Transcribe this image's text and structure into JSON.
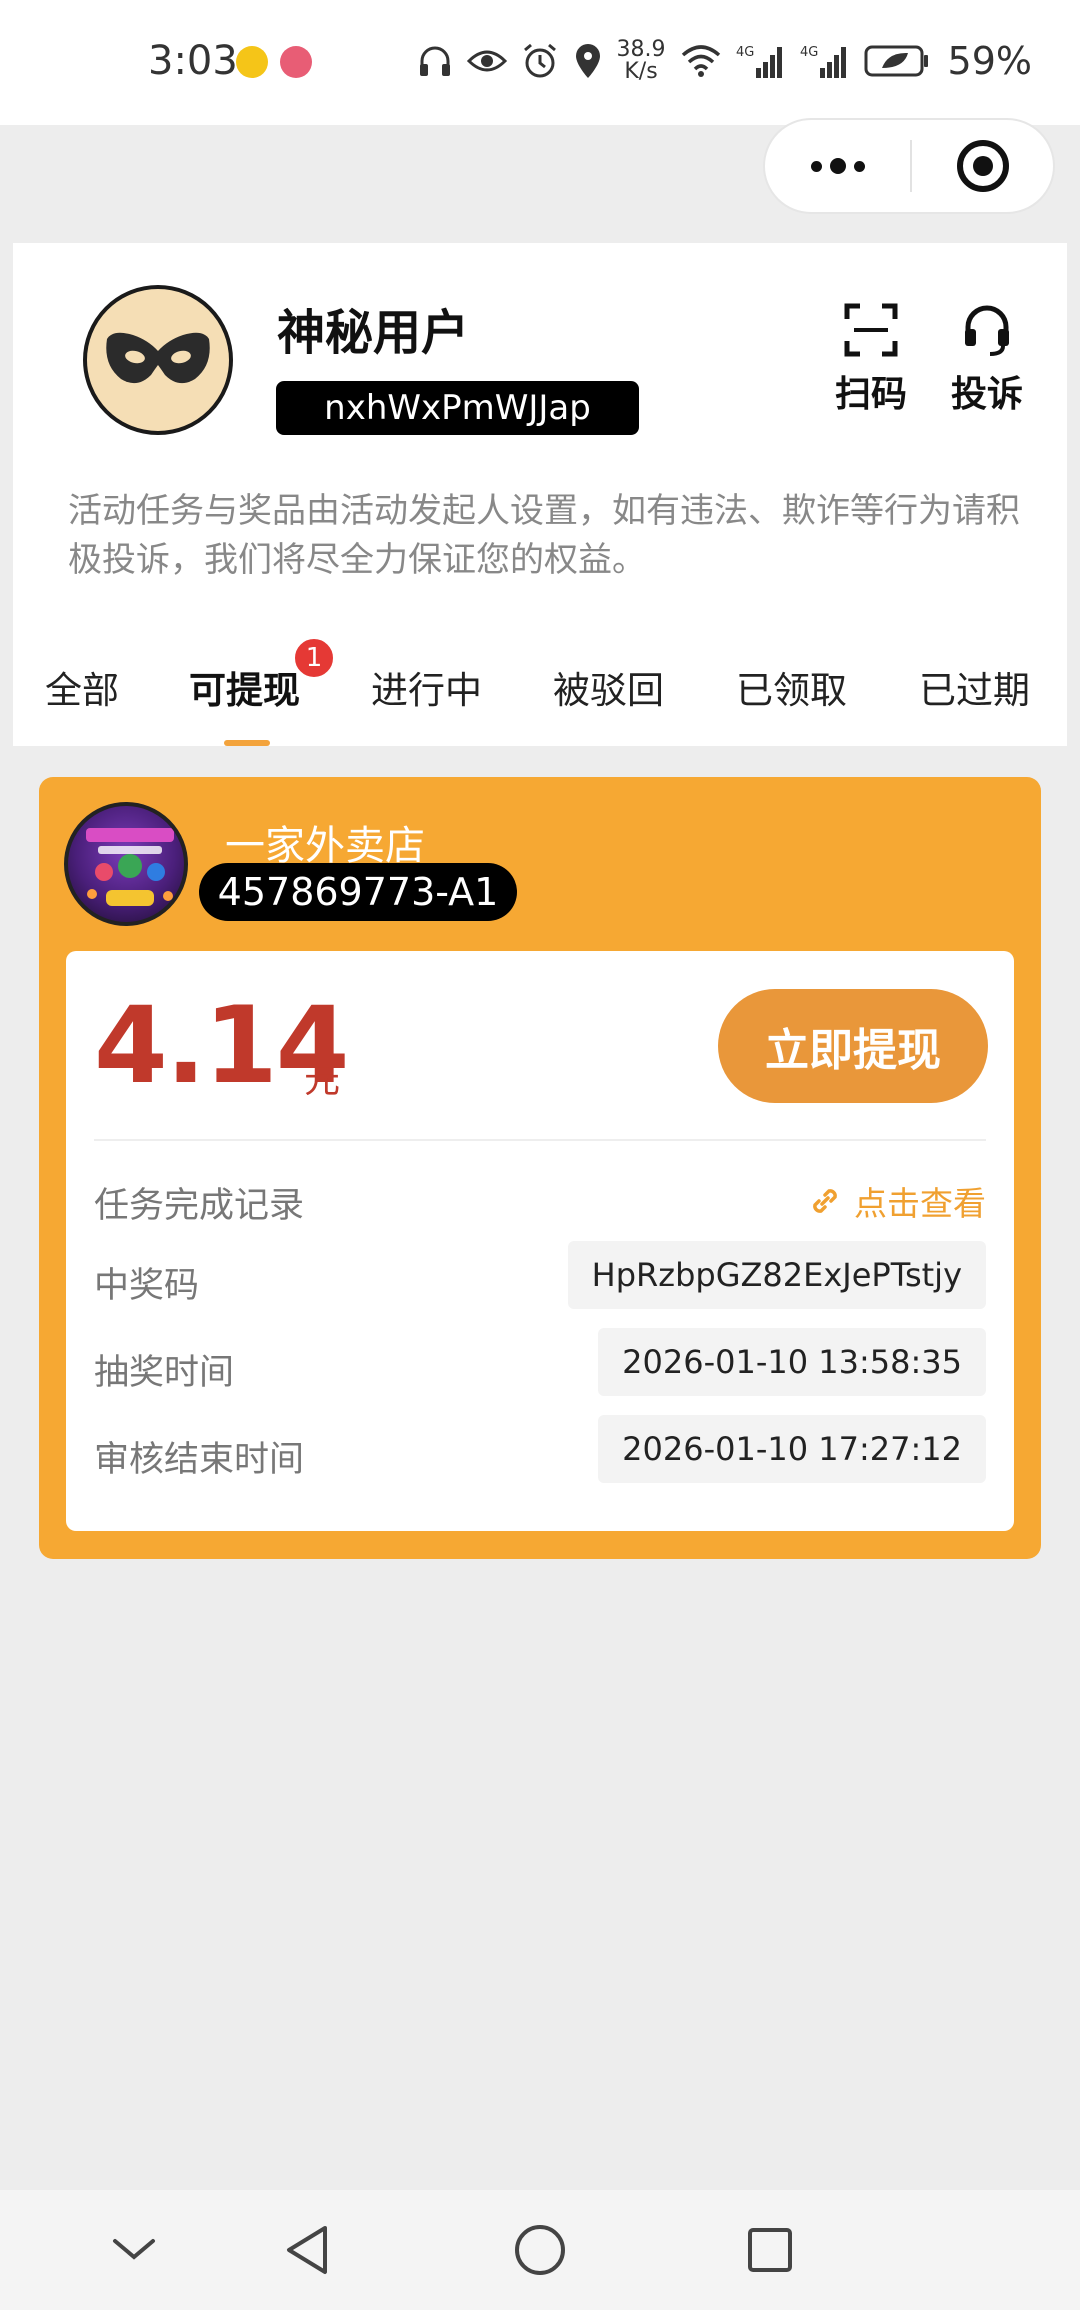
{
  "status_bar": {
    "time": "3:03",
    "net_speed_value": "38.9",
    "net_speed_unit": "K/s",
    "signal1": "4G",
    "signal2": "4G",
    "battery": "59%"
  },
  "header": {
    "username": "神秘用户",
    "user_id": "nxhWxPmWJJap",
    "scan_label": "扫码",
    "complain_label": "投诉",
    "notice": "活动任务与奖品由活动发起人设置，如有违法、欺诈等行为请积极投诉，我们将尽全力保证您的权益。"
  },
  "tabs": [
    {
      "label": "全部"
    },
    {
      "label": "可提现",
      "badge": "1"
    },
    {
      "label": "进行中"
    },
    {
      "label": "被驳回"
    },
    {
      "label": "已领取"
    },
    {
      "label": "已过期"
    }
  ],
  "prize": {
    "shop_name": "一家外卖店",
    "shop_code": "457869773-A1",
    "amount": "4.14",
    "unit": "元",
    "withdraw_label": "立即提现",
    "task_record_label": "任务完成记录",
    "view_label": "点击查看",
    "code_label": "中奖码",
    "code_value": "HpRzbpGZ82ExJePTstjy",
    "draw_time_label": "抽奖时间",
    "draw_time_value": "2026-01-10 13:58:35",
    "review_end_label": "审核结束时间",
    "review_end_value": "2026-01-10 17:27:12"
  },
  "colors": {
    "accent_orange": "#f6a833",
    "button_orange": "#e9973a",
    "amount_red": "#c0392b",
    "badge_red": "#e53935"
  }
}
